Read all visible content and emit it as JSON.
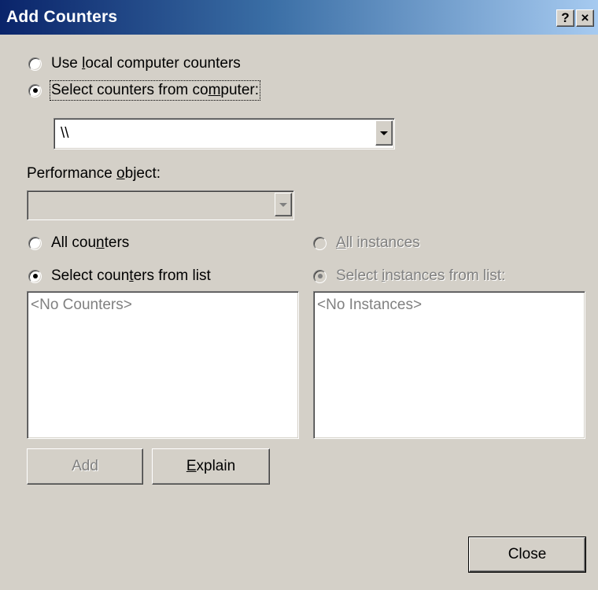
{
  "window": {
    "title": "Add Counters",
    "help_glyph": "?",
    "close_glyph": "×"
  },
  "source": {
    "use_local": {
      "label_pre": "Use ",
      "label_u": "l",
      "label_post": "ocal computer counters",
      "checked": false
    },
    "select_from": {
      "label_pre": "Select counters from co",
      "label_u": "m",
      "label_post": "puter:",
      "checked": true
    },
    "computer_value": "\\\\"
  },
  "performance_object": {
    "label_pre": "Performance ",
    "label_u": "o",
    "label_post": "bject:",
    "value": ""
  },
  "counters": {
    "all": {
      "label_pre": "All cou",
      "label_u": "n",
      "label_post": "ters",
      "checked": false
    },
    "list": {
      "label_pre": "Select coun",
      "label_u": "t",
      "label_post": "ers from list",
      "checked": true
    },
    "items": [
      "<No Counters>"
    ]
  },
  "instances": {
    "all": {
      "label_pre": "",
      "label_u": "A",
      "label_post": "ll instances",
      "checked": false
    },
    "list": {
      "label_pre": "Select ",
      "label_u": "i",
      "label_post": "nstances from list:",
      "checked": true
    },
    "items": [
      "<No Instances>"
    ]
  },
  "buttons": {
    "add": "Add",
    "explain_u": "E",
    "explain_rest": "xplain",
    "close": "Close"
  }
}
